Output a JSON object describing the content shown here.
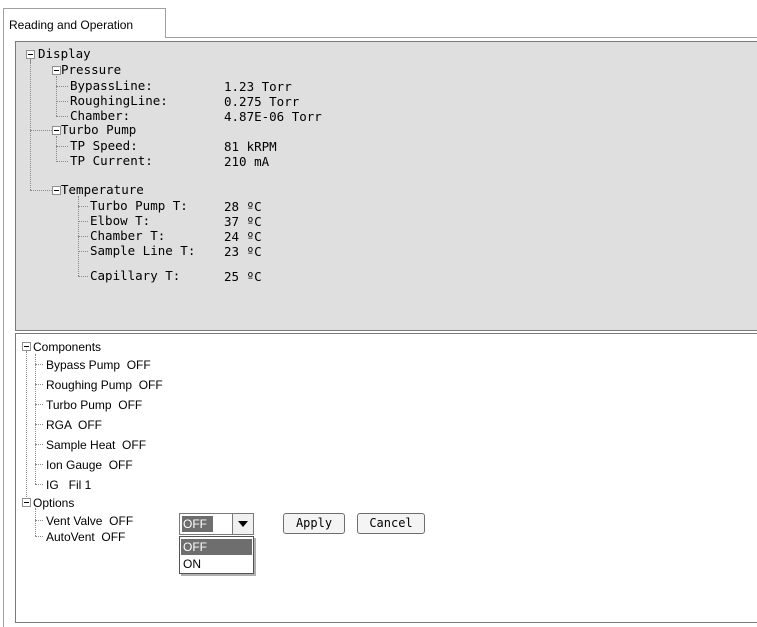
{
  "tab": {
    "label": "Reading and Operation"
  },
  "display": {
    "root": "Display",
    "pressure": {
      "label": "Pressure",
      "rows": [
        {
          "name": "BypassLine:",
          "value": "1.23 Torr"
        },
        {
          "name": "RoughingLine:",
          "value": "0.275 Torr"
        },
        {
          "name": "Chamber:",
          "value": "4.87E-06 Torr"
        }
      ]
    },
    "turbo": {
      "label": "Turbo Pump",
      "rows": [
        {
          "name": "TP Speed:",
          "value": "81 kRPM"
        },
        {
          "name": "TP Current:",
          "value": "210 mA"
        }
      ]
    },
    "temperature": {
      "label": "Temperature",
      "rows": [
        {
          "name": "Turbo Pump T:",
          "value": "28 ºC"
        },
        {
          "name": "Elbow T:",
          "value": "37 ºC"
        },
        {
          "name": "Chamber T:",
          "value": "24 ºC"
        },
        {
          "name": "Sample Line T:",
          "value": "23 ºC"
        },
        {
          "name": "Capillary T:",
          "value": "25 ºC"
        }
      ]
    }
  },
  "components": {
    "label": "Components",
    "items": [
      "Bypass Pump  OFF",
      "Roughing Pump  OFF",
      "Turbo Pump  OFF",
      "RGA  OFF",
      "Sample Heat  OFF",
      "Ion Gauge  OFF",
      "IG   Fil 1"
    ]
  },
  "options": {
    "label": "Options",
    "items": [
      "Vent Valve  OFF",
      "AutoVent  OFF"
    ]
  },
  "combo": {
    "selected": "OFF",
    "options": [
      "OFF",
      "ON"
    ]
  },
  "buttons": {
    "apply": "Apply",
    "cancel": "Cancel"
  },
  "colors": {
    "display_bg": "#dfdfdf",
    "selection": "#6e6e6e"
  }
}
